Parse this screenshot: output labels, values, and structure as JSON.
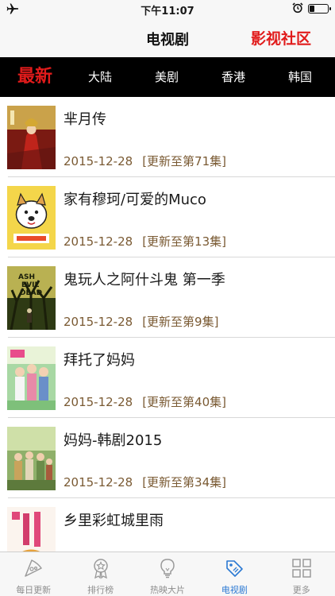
{
  "status_bar": {
    "time": "下午11:07"
  },
  "nav": {
    "title": "电视剧",
    "right_link": "影视社区"
  },
  "categories": [
    {
      "label": "最新",
      "active": true
    },
    {
      "label": "大陆",
      "active": false
    },
    {
      "label": "美剧",
      "active": false
    },
    {
      "label": "香港",
      "active": false
    },
    {
      "label": "韩国",
      "active": false
    }
  ],
  "shows": [
    {
      "title": "芈月传",
      "date": "2015-12-28",
      "update": "[更新至第71集]"
    },
    {
      "title": "家有穆珂/可爱的Muco",
      "date": "2015-12-28",
      "update": "[更新至第13集]"
    },
    {
      "title": "鬼玩人之阿什斗鬼 第一季",
      "date": "2015-12-28",
      "update": "[更新至第9集]"
    },
    {
      "title": "拜托了妈妈",
      "date": "2015-12-28",
      "update": "[更新至第40集]"
    },
    {
      "title": "妈妈-韩剧2015",
      "date": "2015-12-28",
      "update": "[更新至第34集]"
    },
    {
      "title": "乡里彩虹城里雨",
      "date": "",
      "update": ""
    }
  ],
  "tab_bar": [
    {
      "label": "每日更新",
      "icon": "pizza-slice-icon",
      "active": false
    },
    {
      "label": "排行榜",
      "icon": "ranking-badge-icon",
      "active": false
    },
    {
      "label": "热映大片",
      "icon": "lightbulb-icon",
      "active": false
    },
    {
      "label": "电视剧",
      "icon": "tag-icon",
      "active": true
    },
    {
      "label": "更多",
      "icon": "grid-icon",
      "active": false
    }
  ],
  "colors": {
    "accent_red": "#e11b1b",
    "active_blue": "#2b79d3",
    "meta_brown": "#7a5a33"
  }
}
